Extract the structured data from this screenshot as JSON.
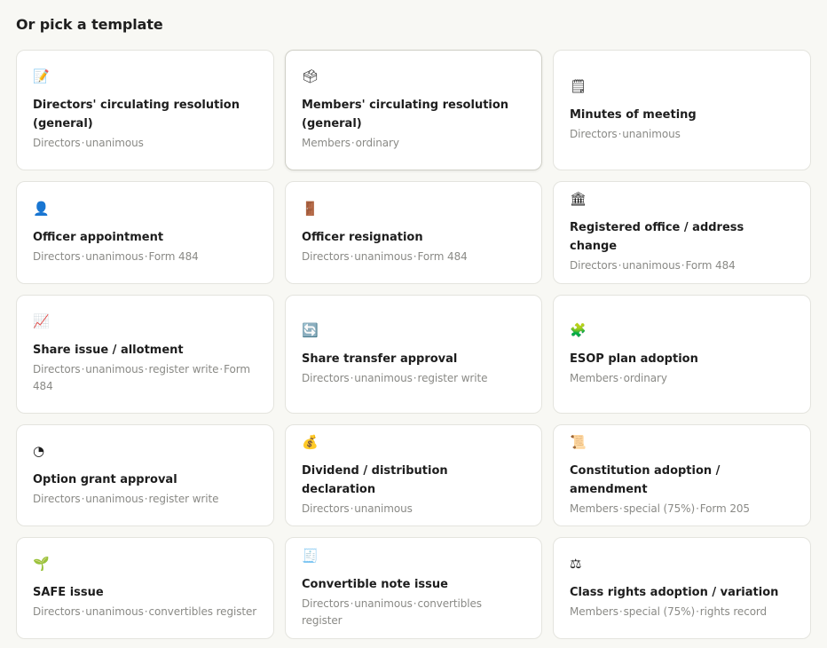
{
  "heading": "Or pick a template",
  "templates": [
    {
      "icon": "📝",
      "icon_name": "memo-icon",
      "title": "Directors' circulating resolution (general)",
      "meta": [
        "Directors",
        "unanimous"
      ]
    },
    {
      "icon": "🗳",
      "icon_name": "ballot-box-icon",
      "title": "Members' circulating resolution (general)",
      "meta": [
        "Members",
        "ordinary"
      ]
    },
    {
      "icon": "🗒",
      "icon_name": "notepad-icon",
      "title": "Minutes of meeting",
      "meta": [
        "Directors",
        "unanimous"
      ]
    },
    {
      "icon": "👤",
      "icon_name": "person-icon",
      "title": "Officer appointment",
      "meta": [
        "Directors",
        "unanimous",
        "Form 484"
      ]
    },
    {
      "icon": "🚪",
      "icon_name": "door-icon",
      "title": "Officer resignation",
      "meta": [
        "Directors",
        "unanimous",
        "Form 484"
      ]
    },
    {
      "icon": "🏛",
      "icon_name": "building-icon",
      "title": "Registered office / address change",
      "meta": [
        "Directors",
        "unanimous",
        "Form 484"
      ]
    },
    {
      "icon": "📈",
      "icon_name": "chart-increasing-icon",
      "title": "Share issue / allotment",
      "meta": [
        "Directors",
        "unanimous",
        "register write",
        "Form 484"
      ]
    },
    {
      "icon": "🔄",
      "icon_name": "arrows-cycle-icon",
      "title": "Share transfer approval",
      "meta": [
        "Directors",
        "unanimous",
        "register write"
      ]
    },
    {
      "icon": "🧩",
      "icon_name": "puzzle-piece-icon",
      "title": "ESOP plan adoption",
      "meta": [
        "Members",
        "ordinary"
      ]
    },
    {
      "icon": "◔",
      "icon_name": "pie-chart-icon",
      "title": "Option grant approval",
      "meta": [
        "Directors",
        "unanimous",
        "register write"
      ]
    },
    {
      "icon": "💰",
      "icon_name": "money-bag-icon",
      "title": "Dividend / distribution declaration",
      "meta": [
        "Directors",
        "unanimous"
      ]
    },
    {
      "icon": "📜",
      "icon_name": "scroll-icon",
      "title": "Constitution adoption / amendment",
      "meta": [
        "Members",
        "special (75%)",
        "Form 205"
      ]
    },
    {
      "icon": "🌱",
      "icon_name": "seedling-icon",
      "title": "SAFE issue",
      "meta": [
        "Directors",
        "unanimous",
        "convertibles register"
      ]
    },
    {
      "icon": "🧾",
      "icon_name": "receipt-icon",
      "title": "Convertible note issue",
      "meta": [
        "Directors",
        "unanimous",
        "convertibles register"
      ]
    },
    {
      "icon": "⚖",
      "icon_name": "scales-icon",
      "title": "Class rights adoption / variation",
      "meta": [
        "Members",
        "special (75%)",
        "rights record"
      ]
    }
  ],
  "meta_separator": "·"
}
